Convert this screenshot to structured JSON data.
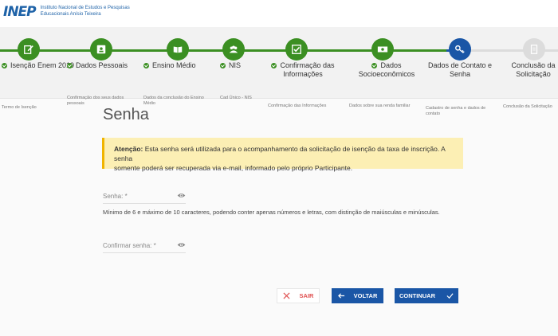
{
  "header": {
    "logo_text": "INEP",
    "org_line1": "Instituto Nacional de Estudos e Pesquisas",
    "org_line2": "Educacionais Anísio Teixeira"
  },
  "steps": [
    {
      "title": "Isenção Enem 2019",
      "subtitle": "Termo de Isenção",
      "status": "done",
      "icon": "edit-icon"
    },
    {
      "title": "Dados Pessoais",
      "subtitle": "Confirmação dos seus dados pessoais",
      "status": "done",
      "icon": "contact-card-icon"
    },
    {
      "title": "Ensino Médio",
      "subtitle": "Dados da conclusão do Ensino Médio",
      "status": "done",
      "icon": "book-icon"
    },
    {
      "title": "NIS",
      "subtitle": "Cad Único - NIS",
      "status": "done",
      "icon": "group-icon"
    },
    {
      "title": "Confirmação das Informações",
      "subtitle": "Confirmação das Informações",
      "status": "done",
      "icon": "checkbox-icon"
    },
    {
      "title": "Dados Socioeconômicos",
      "subtitle": "Dados sobre sua renda familiar",
      "status": "done",
      "icon": "money-icon"
    },
    {
      "title": "Dados de Contato e Senha",
      "subtitle": "Cadastro de senha e dados de contato",
      "status": "current",
      "icon": "key-icon"
    },
    {
      "title": "Conclusão da Solicitação",
      "subtitle": "Conclusão da Solicitação",
      "status": "pending",
      "icon": "document-icon"
    }
  ],
  "colors": {
    "done": "#3b8f22",
    "current": "#1a56a6",
    "pending": "#dcdcdc",
    "alert_bg": "#fcefb4",
    "alert_border": "#f0b400"
  },
  "page": {
    "title": "Senha"
  },
  "alert": {
    "label": "Atenção:",
    "text_line1": " Esta senha será utilizada para o acompanhamento da solicitação de isenção da taxa de inscrição. A senha",
    "text_line2": "somente poderá ser recuperada via e-mail, informado pelo próprio Participante."
  },
  "form": {
    "password_label": "Senha: *",
    "password_hint": "Mínimo de 6 e máximo de 10 caracteres, podendo conter apenas números e letras, com distinção de maiúsculas e minúsculas.",
    "confirm_label": "Confirmar senha: *"
  },
  "buttons": {
    "exit": "SAIR",
    "back": "VOLTAR",
    "continue": "CONTINUAR"
  }
}
